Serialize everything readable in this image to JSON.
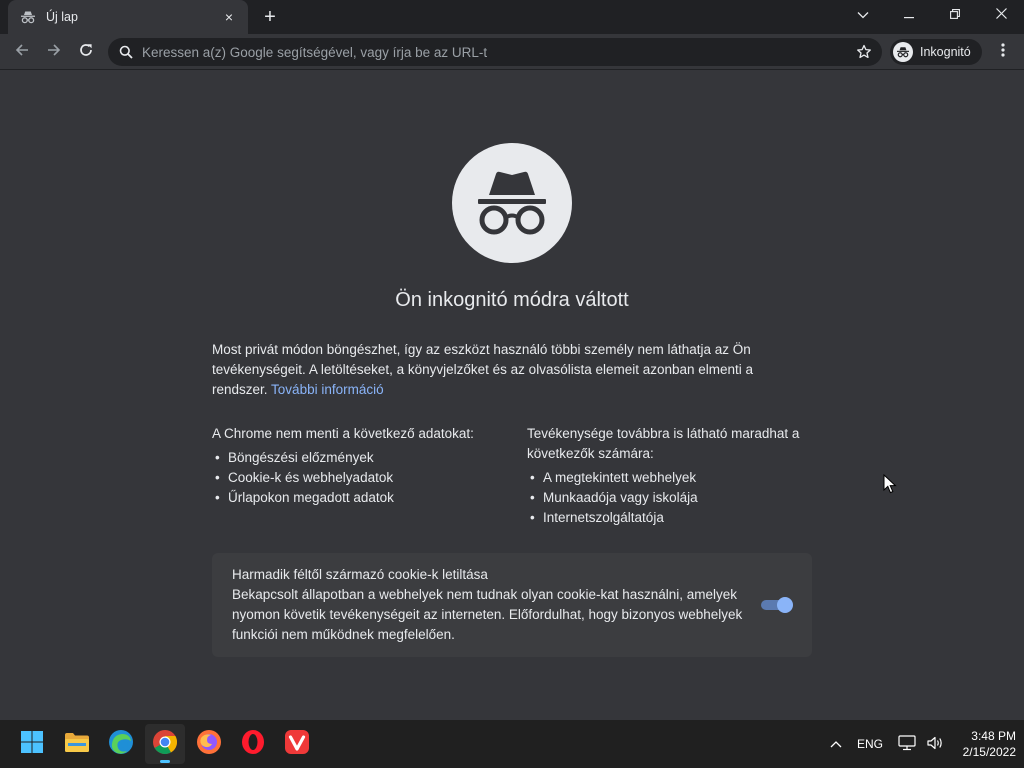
{
  "tab": {
    "title": "Új lap",
    "close_icon": "×"
  },
  "window": {
    "newtab_icon": "+"
  },
  "toolbar": {
    "omnibox_placeholder": "Keressen a(z) Google segítségével, vagy írja be az URL-t",
    "incognito_label": "Inkognitó"
  },
  "page": {
    "title": "Ön inkognitó módra váltott",
    "intro": "Most privát módon böngészhet, így az eszközt használó többi személy nem láthatja az Ön tevékenységeit. A letöltéseket, a könyvjelzőket és az olvasólista elemeit azonban elmenti a rendszer.",
    "learn_more": "További információ",
    "not_saved": {
      "heading": "A Chrome nem menti a következő adatokat:",
      "items": [
        "Böngészési előzmények",
        "Cookie-k és webhelyadatok",
        "Űrlapokon megadott adatok"
      ]
    },
    "visible": {
      "heading": "Tevékenysége továbbra is látható maradhat a következők számára:",
      "items": [
        "A megtekintett webhelyek",
        "Munkaadója vagy iskolája",
        "Internetszolgáltatója"
      ]
    },
    "cookie_card": {
      "title": "Harmadik féltől származó cookie-k letiltása",
      "description": "Bekapcsolt állapotban a webhelyek nem tudnak olyan cookie-kat használni, amelyek nyomon követik tevékenységeit az interneten. Előfordulhat, hogy bizonyos webhelyek funkciói nem működnek megfelelően.",
      "toggle_on": true
    }
  },
  "taskbar": {
    "apps": [
      "start",
      "file-explorer",
      "edge",
      "chrome",
      "firefox",
      "opera",
      "vivaldi"
    ],
    "language": "ENG",
    "time": "3:48 PM",
    "date": "2/15/2022"
  },
  "colors": {
    "accent": "#8ab4f8",
    "background": "#35363a",
    "frame": "#202124"
  }
}
